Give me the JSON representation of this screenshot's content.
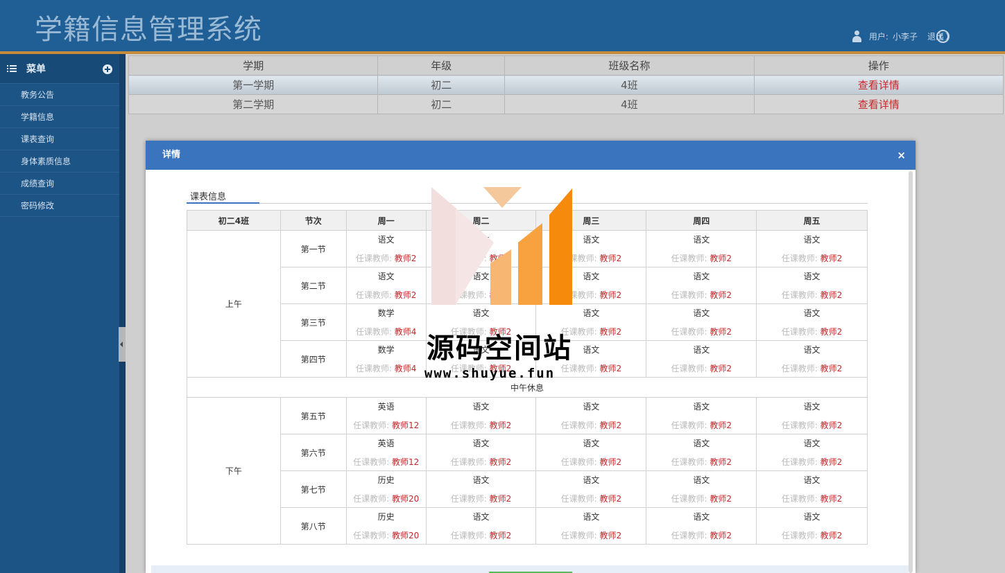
{
  "header": {
    "title": "学籍信息管理系统",
    "user_label": "用户:",
    "user_name": "小李子",
    "logout": "退出"
  },
  "sidebar": {
    "menu_title": "菜单",
    "items": [
      "教务公告",
      "学籍信息",
      "课表查询",
      "身体素质信息",
      "成绩查询",
      "密码修改"
    ]
  },
  "term_table": {
    "headers": [
      "学期",
      "年级",
      "班级名称",
      "操作"
    ],
    "rows": [
      [
        "第一学期",
        "初二",
        "4班",
        "查看详情"
      ],
      [
        "第二学期",
        "初二",
        "4班",
        "查看详情"
      ]
    ]
  },
  "modal": {
    "title": "详情",
    "close": "×",
    "section": "课表信息",
    "schedule": {
      "class_name": "初二4班",
      "period_header": "节次",
      "days": [
        "周一",
        "周二",
        "周三",
        "周四",
        "周五"
      ],
      "teacher_label": "任课教师:",
      "morning": "上午",
      "afternoon": "下午",
      "noon_break": "中午休息",
      "periods": [
        {
          "name": "第一节",
          "cells": [
            [
              "语文",
              "教师2"
            ],
            [
              "语文",
              "教师2"
            ],
            [
              "语文",
              "教师2"
            ],
            [
              "语文",
              "教师2"
            ],
            [
              "语文",
              "教师2"
            ]
          ]
        },
        {
          "name": "第二节",
          "cells": [
            [
              "语文",
              "教师2"
            ],
            [
              "语文",
              "教师2"
            ],
            [
              "语文",
              "教师2"
            ],
            [
              "语文",
              "教师2"
            ],
            [
              "语文",
              "教师2"
            ]
          ]
        },
        {
          "name": "第三节",
          "cells": [
            [
              "数学",
              "教师4"
            ],
            [
              "语文",
              "教师2"
            ],
            [
              "语文",
              "教师2"
            ],
            [
              "语文",
              "教师2"
            ],
            [
              "语文",
              "教师2"
            ]
          ]
        },
        {
          "name": "第四节",
          "cells": [
            [
              "数学",
              "教师4"
            ],
            [
              "语文",
              "教师2"
            ],
            [
              "语文",
              "教师2"
            ],
            [
              "语文",
              "教师2"
            ],
            [
              "语文",
              "教师2"
            ]
          ]
        },
        {
          "name": "第五节",
          "cells": [
            [
              "英语",
              "教师12"
            ],
            [
              "语文",
              "教师2"
            ],
            [
              "语文",
              "教师2"
            ],
            [
              "语文",
              "教师2"
            ],
            [
              "语文",
              "教师2"
            ]
          ]
        },
        {
          "name": "第六节",
          "cells": [
            [
              "英语",
              "教师12"
            ],
            [
              "语文",
              "教师2"
            ],
            [
              "语文",
              "教师2"
            ],
            [
              "语文",
              "教师2"
            ],
            [
              "语文",
              "教师2"
            ]
          ]
        },
        {
          "name": "第七节",
          "cells": [
            [
              "历史",
              "教师20"
            ],
            [
              "语文",
              "教师2"
            ],
            [
              "语文",
              "教师2"
            ],
            [
              "语文",
              "教师2"
            ],
            [
              "语文",
              "教师2"
            ]
          ]
        },
        {
          "name": "第八节",
          "cells": [
            [
              "历史",
              "教师20"
            ],
            [
              "语文",
              "教师2"
            ],
            [
              "语文",
              "教师2"
            ],
            [
              "语文",
              "教师2"
            ],
            [
              "语文",
              "教师2"
            ]
          ]
        }
      ]
    }
  },
  "watermark": {
    "text": "源码空间站",
    "url": "www.shuyue.fun"
  },
  "colors": {
    "header_bg": "#1f5f95",
    "sidebar_bg": "#1d5486",
    "modal_head": "#3a73be",
    "link_red": "#c2292a",
    "accent_orange": "#c58a3a"
  }
}
